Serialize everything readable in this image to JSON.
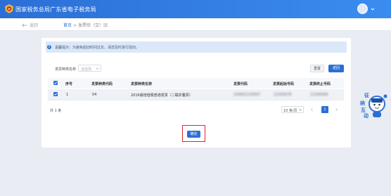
{
  "header": {
    "title": "国家税务总局广东省电子税务局"
  },
  "subnav": {
    "back_label": "返回",
    "breadcrumb": {
      "home": "首页",
      "separator": ">",
      "current": "发票验（交）旧"
    }
  },
  "tip": {
    "icon": "info-icon",
    "text": "温馨提示：为避免验旧时间过长，请您及时进行验旧。"
  },
  "filter": {
    "label": "发票种类名称",
    "select_placeholder": "请选择"
  },
  "buttons": {
    "reset": "重置",
    "back": "返回",
    "confirm": "确定"
  },
  "table": {
    "columns": [
      "序号",
      "发票种类代码",
      "发票种类名称",
      "发票代码",
      "发票起始号码",
      "发票终止号码"
    ],
    "rows": [
      {
        "checked": true,
        "index": "1",
        "type_code": "04",
        "type_name": "2016版增值税普通发票（二联折叠票）",
        "invoice_code": "144001234567",
        "start_no": "12345678",
        "end_no": "12345699"
      }
    ]
  },
  "pagination": {
    "total": "共 1 条",
    "page_size": "10 条/页",
    "current_page": "1"
  },
  "mascot": {
    "chars": [
      "征",
      "纳",
      "互",
      "动"
    ]
  },
  "colors": {
    "brand_blue": "#2b6fd6",
    "highlight_red": "#e0252b"
  }
}
